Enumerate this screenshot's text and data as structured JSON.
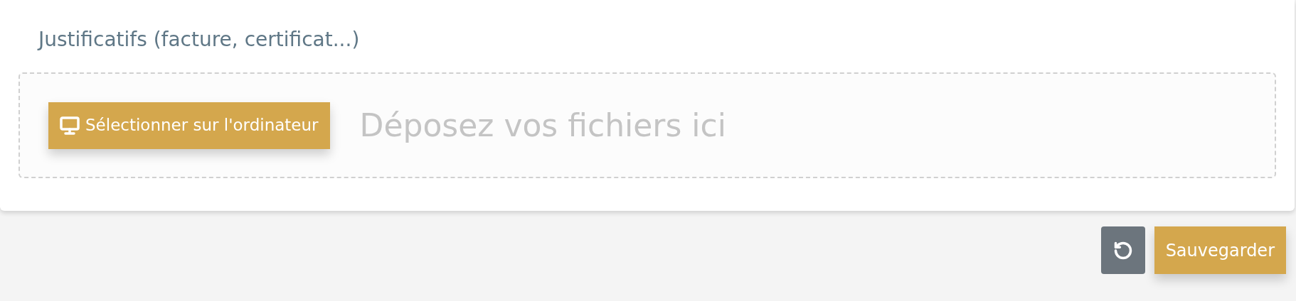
{
  "section": {
    "title": "Justificatifs (facture, certificat...)"
  },
  "dropzone": {
    "select_button": "Sélectionner sur l'ordinateur",
    "placeholder": "Déposez vos fichiers ici"
  },
  "actions": {
    "save_button": "Sauvegarder"
  }
}
